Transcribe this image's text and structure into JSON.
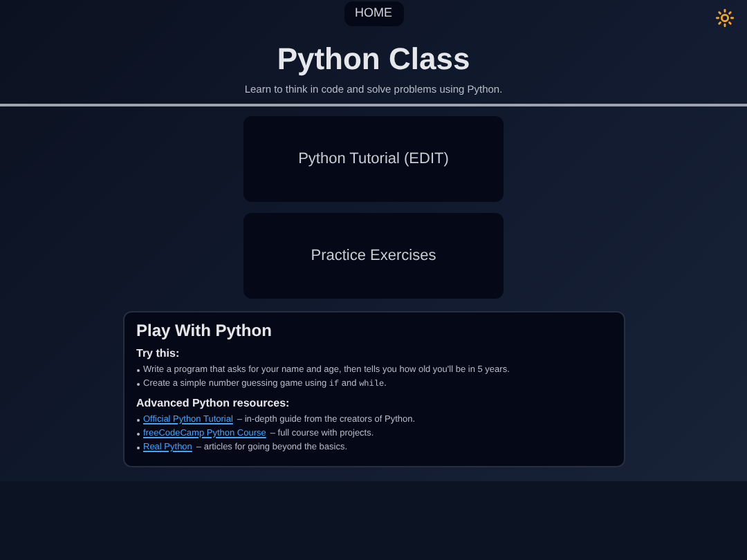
{
  "nav": {
    "home": "HOME"
  },
  "header": {
    "title": "Python Class",
    "subtitle": "Learn to think in code and solve problems using Python."
  },
  "cards": [
    {
      "label": "Python Tutorial (EDIT)"
    },
    {
      "label": "Practice Exercises"
    }
  ],
  "panel": {
    "title": "Play With Python",
    "try_heading": "Try this:",
    "try_items": [
      [
        {
          "kind": "text",
          "text": "Write a program that asks for your name and age, then tells you how old you'll be in 5 years."
        }
      ],
      [
        {
          "kind": "text",
          "text": "Create a simple number guessing game using "
        },
        {
          "kind": "code",
          "text": "if"
        },
        {
          "kind": "text",
          "text": " and "
        },
        {
          "kind": "code",
          "text": "while"
        },
        {
          "kind": "text",
          "text": "."
        }
      ]
    ],
    "resources_heading": "Advanced Python resources:",
    "resources": [
      {
        "link": "Official Python Tutorial",
        "description": "– in-depth guide from the creators of Python."
      },
      {
        "link": "freeCodeCamp Python Course",
        "description": "– full course with projects."
      },
      {
        "link": "Real Python",
        "description": "– articles for going beyond the basics."
      }
    ]
  }
}
